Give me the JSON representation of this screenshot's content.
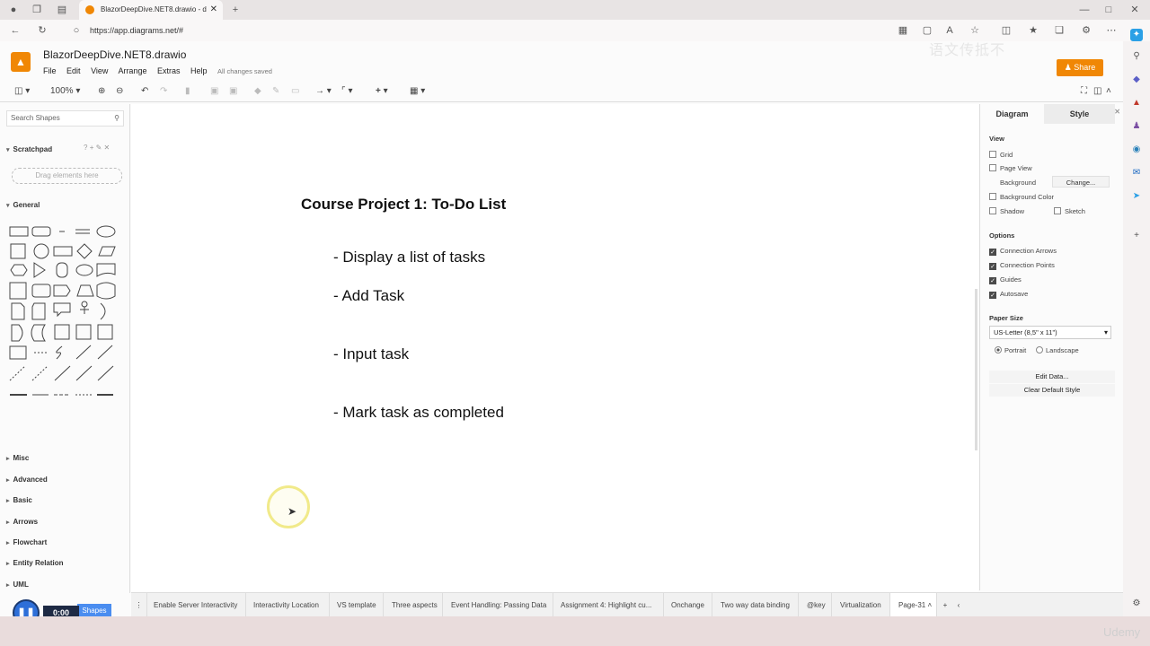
{
  "browser": {
    "tab_title": "BlazorDeepDive.NET8.drawio - d",
    "url": "https://app.diagrams.net/#"
  },
  "app": {
    "doc_title": "BlazorDeepDive.NET8.drawio",
    "menu": [
      "File",
      "Edit",
      "View",
      "Arrange",
      "Extras",
      "Help"
    ],
    "saved_status": "All changes saved",
    "share_label": "Share",
    "watermark": "语文传抵不",
    "zoom": "100%"
  },
  "left_panel": {
    "search_placeholder": "Search Shapes",
    "scratchpad": "Scratchpad",
    "drag_hint": "Drag elements here",
    "sections": [
      "General",
      "Misc",
      "Advanced",
      "Basic",
      "Arrows",
      "Flowchart",
      "Entity Relation",
      "UML"
    ],
    "more_shapes": "Shapes"
  },
  "canvas": {
    "title": "Course Project 1: To-Do List",
    "bullets": [
      "- Display a list of tasks",
      "- Add Task",
      "- Input task",
      "- Mark task as completed"
    ]
  },
  "right_panel": {
    "tab_diagram": "Diagram",
    "tab_style": "Style",
    "view_heading": "View",
    "grid": "Grid",
    "page_view": "Page View",
    "background": "Background",
    "change": "Change...",
    "background_color": "Background Color",
    "shadow": "Shadow",
    "sketch": "Sketch",
    "options_heading": "Options",
    "connection_arrows": "Connection Arrows",
    "connection_points": "Connection Points",
    "guides": "Guides",
    "autosave": "Autosave",
    "paper_size_heading": "Paper Size",
    "paper_size_value": "US-Letter (8,5\" x 11\")",
    "portrait": "Portrait",
    "landscape": "Landscape",
    "edit_data": "Edit Data...",
    "clear_default_style": "Clear Default Style"
  },
  "pages": [
    "Enable Server Interactivity",
    "Interactivity Location",
    "VS template",
    "Three aspects",
    "Event Handling: Passing Data",
    "Assignment 4: Highlight cu...",
    "Onchange",
    "Two way data binding",
    "@key",
    "Virtualization",
    "Page-31"
  ],
  "player": {
    "time": "0:00"
  },
  "branding": "Udemy"
}
